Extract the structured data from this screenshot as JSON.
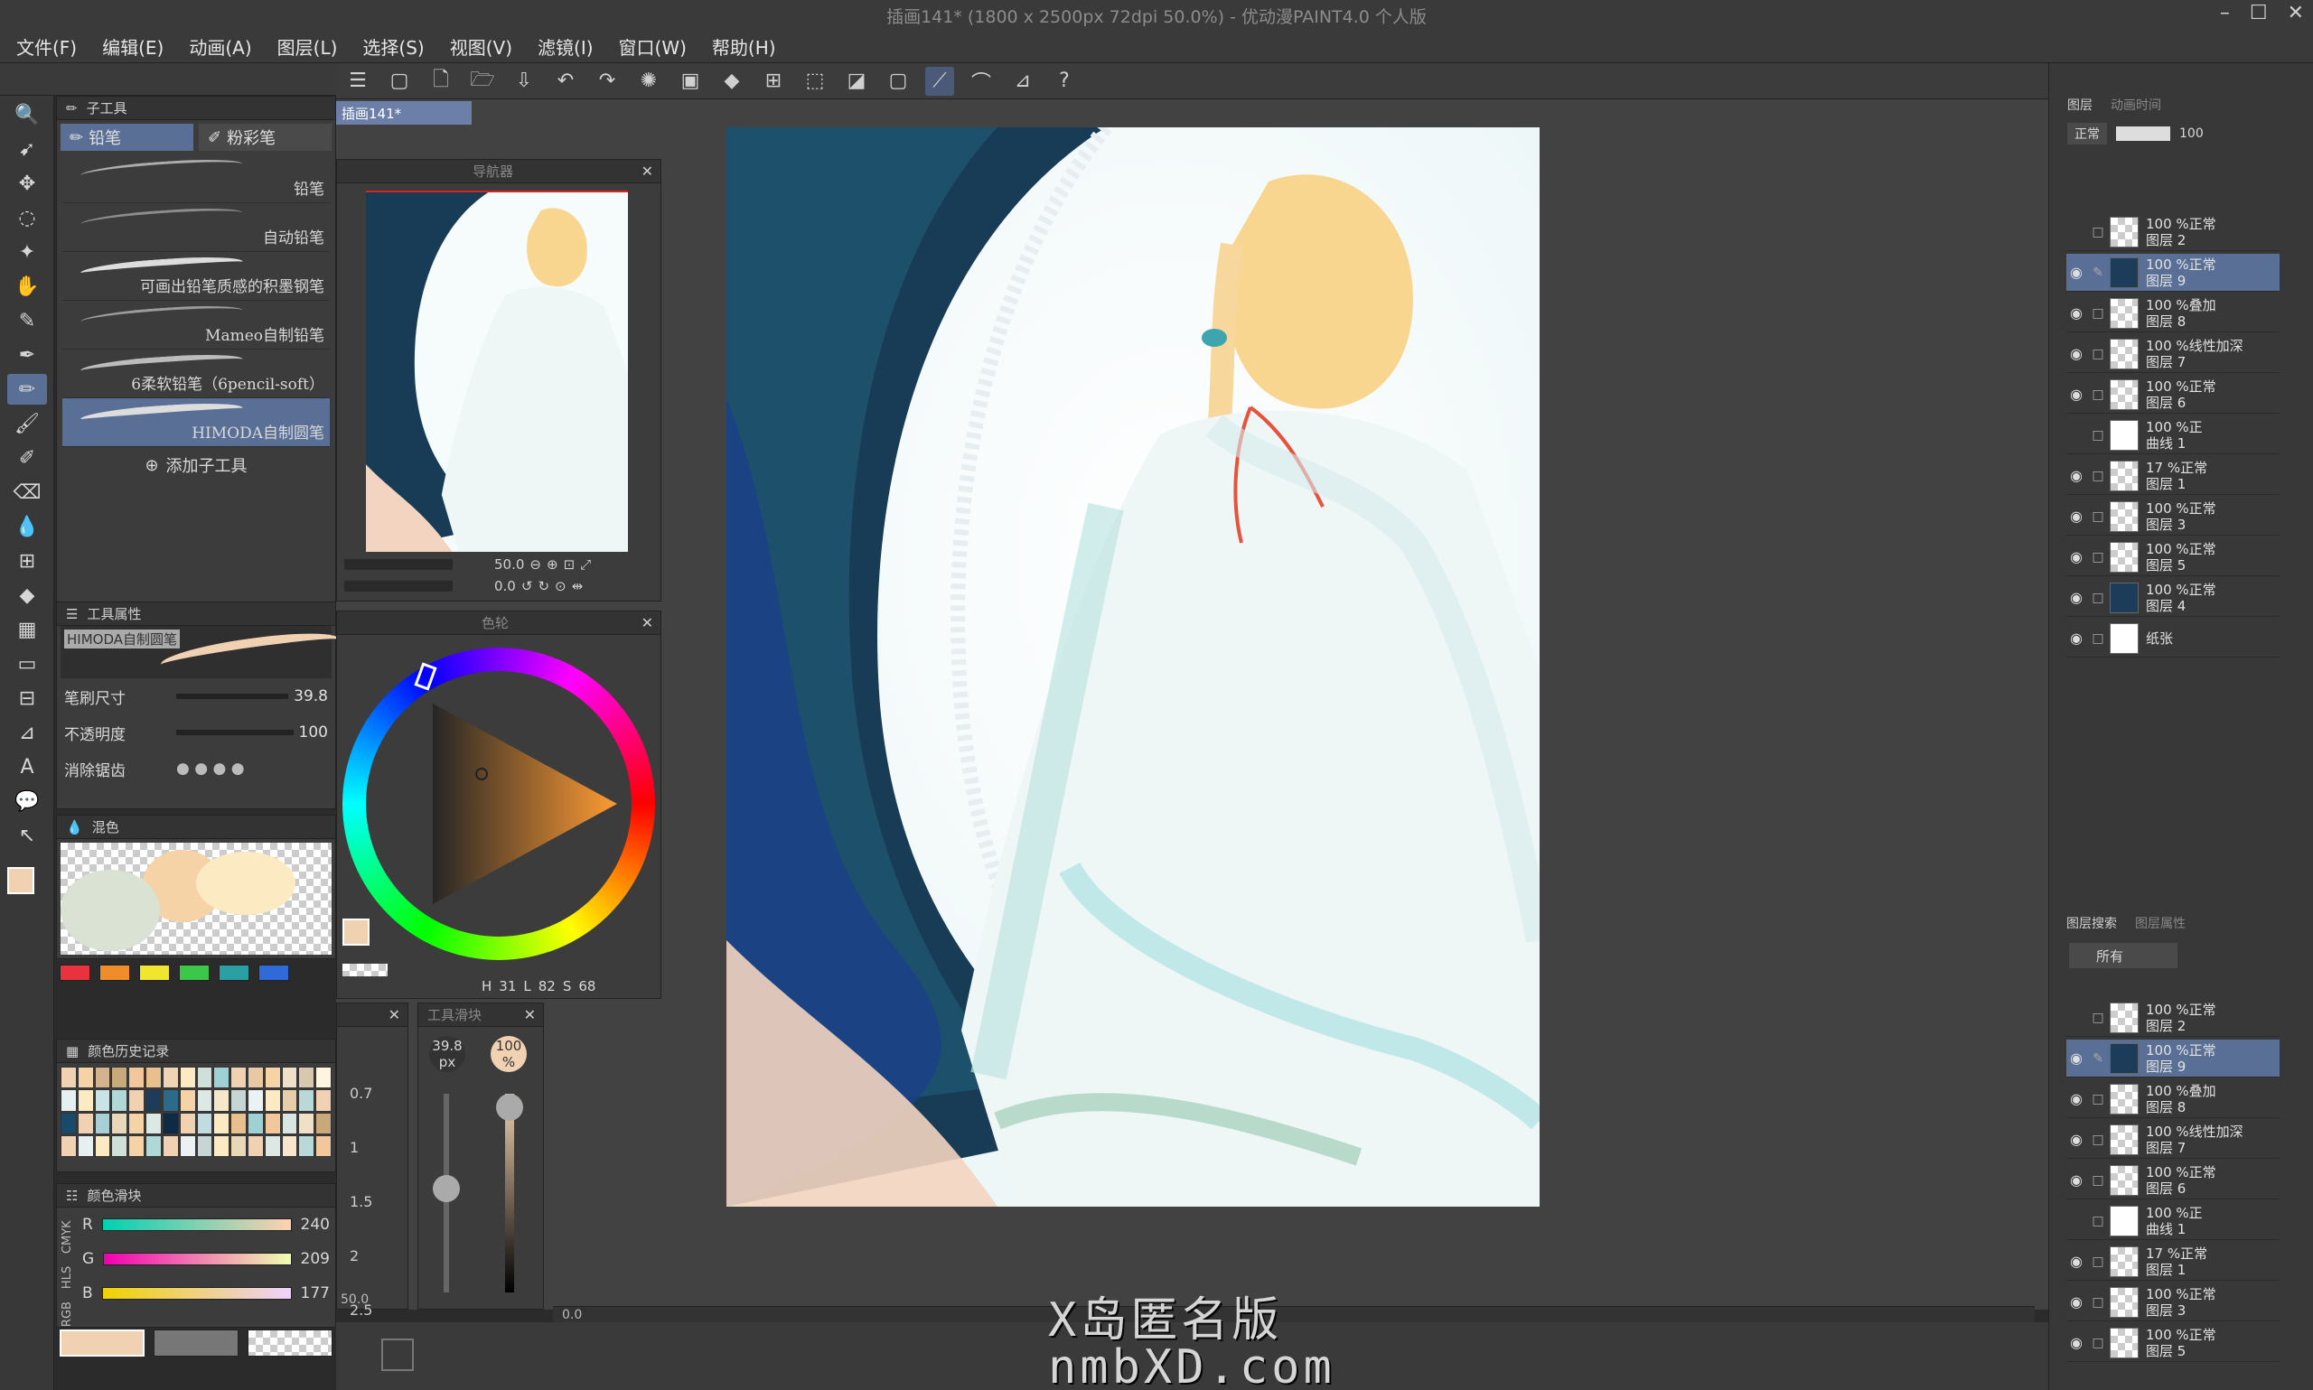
{
  "window": {
    "title": "插画141* (1800 x 2500px 72dpi 50.0%)  - 优动漫PAINT4.0 个人版"
  },
  "menu": [
    "文件(F)",
    "编辑(E)",
    "动画(A)",
    "图层(L)",
    "选择(S)",
    "视图(V)",
    "滤镜(I)",
    "窗口(W)",
    "帮助(H)"
  ],
  "subtool": {
    "panel_title": "子工具",
    "tabs": [
      "铅笔",
      "粉彩笔"
    ],
    "brushes": [
      "铅笔",
      "自动铅笔",
      "可画出铅笔质感的积墨钢笔",
      "Mameo自制铅笔",
      "6柔软铅笔（6pencil-soft）",
      "HIMODA自制圆笔"
    ],
    "add_label": "添加子工具"
  },
  "tool_property": {
    "panel_title": "工具属性",
    "brush_name": "HIMODA自制圆笔",
    "size_label": "笔刷尺寸",
    "size_value": "39.8",
    "opacity_label": "不透明度",
    "opacity_value": "100",
    "aa_label": "消除锯齿"
  },
  "mix_panel": {
    "title": "混色"
  },
  "history_panel": {
    "title": "颜色历史记录"
  },
  "slider_panel": {
    "title": "颜色滑块",
    "modes": [
      "RGB",
      "HLS",
      "CMYK"
    ],
    "r_label": "R",
    "r_value": "240",
    "g_label": "G",
    "g_value": "209",
    "b_label": "B",
    "b_value": "177"
  },
  "document_tab": "插画141*",
  "navigator": {
    "title": "导航器",
    "zoom": "50.0",
    "angle": "0.0"
  },
  "color_wheel": {
    "title": "色轮",
    "h_label": "H",
    "h_value": "31",
    "l_label": "L",
    "l_value": "82",
    "s_label": "S",
    "s_value": "68"
  },
  "rotation_values": [
    "0.7",
    "1",
    "1.5",
    "2",
    "2.5"
  ],
  "rotation_footer": "50.0",
  "brush_size_panel": {
    "title": "工具滑块",
    "size": "39.8",
    "size_unit": "px",
    "opacity": "100",
    "opacity_unit": "%"
  },
  "hscroll_value": "0.0",
  "layer_panel": {
    "tabs": [
      "图层",
      "动画时间"
    ],
    "blend_mode": "正常",
    "opacity": "100",
    "layers": [
      {
        "pct": "100 %正常",
        "name": "图层 2",
        "visible": false,
        "active": false
      },
      {
        "pct": "100 %正常",
        "name": "图层 9",
        "visible": true,
        "active": true
      },
      {
        "pct": "100 %叠加",
        "name": "图层 8",
        "visible": true,
        "active": false
      },
      {
        "pct": "100 %线性加深",
        "name": "图层 7",
        "visible": true,
        "active": false
      },
      {
        "pct": "100 %正常",
        "name": "图层 6",
        "visible": true,
        "active": false
      },
      {
        "pct": "100 %正",
        "name": "曲线 1",
        "visible": false,
        "active": false
      },
      {
        "pct": "17 %正常",
        "name": "图层 1",
        "visible": true,
        "active": false
      },
      {
        "pct": "100 %正常",
        "name": "图层 3",
        "visible": true,
        "active": false
      },
      {
        "pct": "100 %正常",
        "name": "图层 5",
        "visible": true,
        "active": false
      },
      {
        "pct": "100 %正常",
        "name": "图层 4",
        "visible": true,
        "active": false
      },
      {
        "pct": "",
        "name": "纸张",
        "visible": true,
        "active": false
      }
    ]
  },
  "layer_search": {
    "tabs": [
      "图层搜索",
      "图层属性"
    ],
    "filter": "所有",
    "layers": [
      {
        "pct": "100 %正常",
        "name": "图层 2",
        "visible": false,
        "active": false
      },
      {
        "pct": "100 %正常",
        "name": "图层 9",
        "visible": true,
        "active": true
      },
      {
        "pct": "100 %叠加",
        "name": "图层 8",
        "visible": true,
        "active": false
      },
      {
        "pct": "100 %线性加深",
        "name": "图层 7",
        "visible": true,
        "active": false
      },
      {
        "pct": "100 %正常",
        "name": "图层 6",
        "visible": true,
        "active": false
      },
      {
        "pct": "100 %正",
        "name": "曲线 1",
        "visible": false,
        "active": false
      },
      {
        "pct": "17 %正常",
        "name": "图层 1",
        "visible": true,
        "active": false
      },
      {
        "pct": "100 %正常",
        "name": "图层 3",
        "visible": true,
        "active": false
      },
      {
        "pct": "100 %正常",
        "name": "图层 5",
        "visible": true,
        "active": false
      }
    ]
  },
  "watermark": {
    "line1": "X岛匿名版",
    "line2": "nmbXD.com"
  },
  "colors": {
    "main_color": "#f0d1b1",
    "accent": "#5a6f96"
  }
}
